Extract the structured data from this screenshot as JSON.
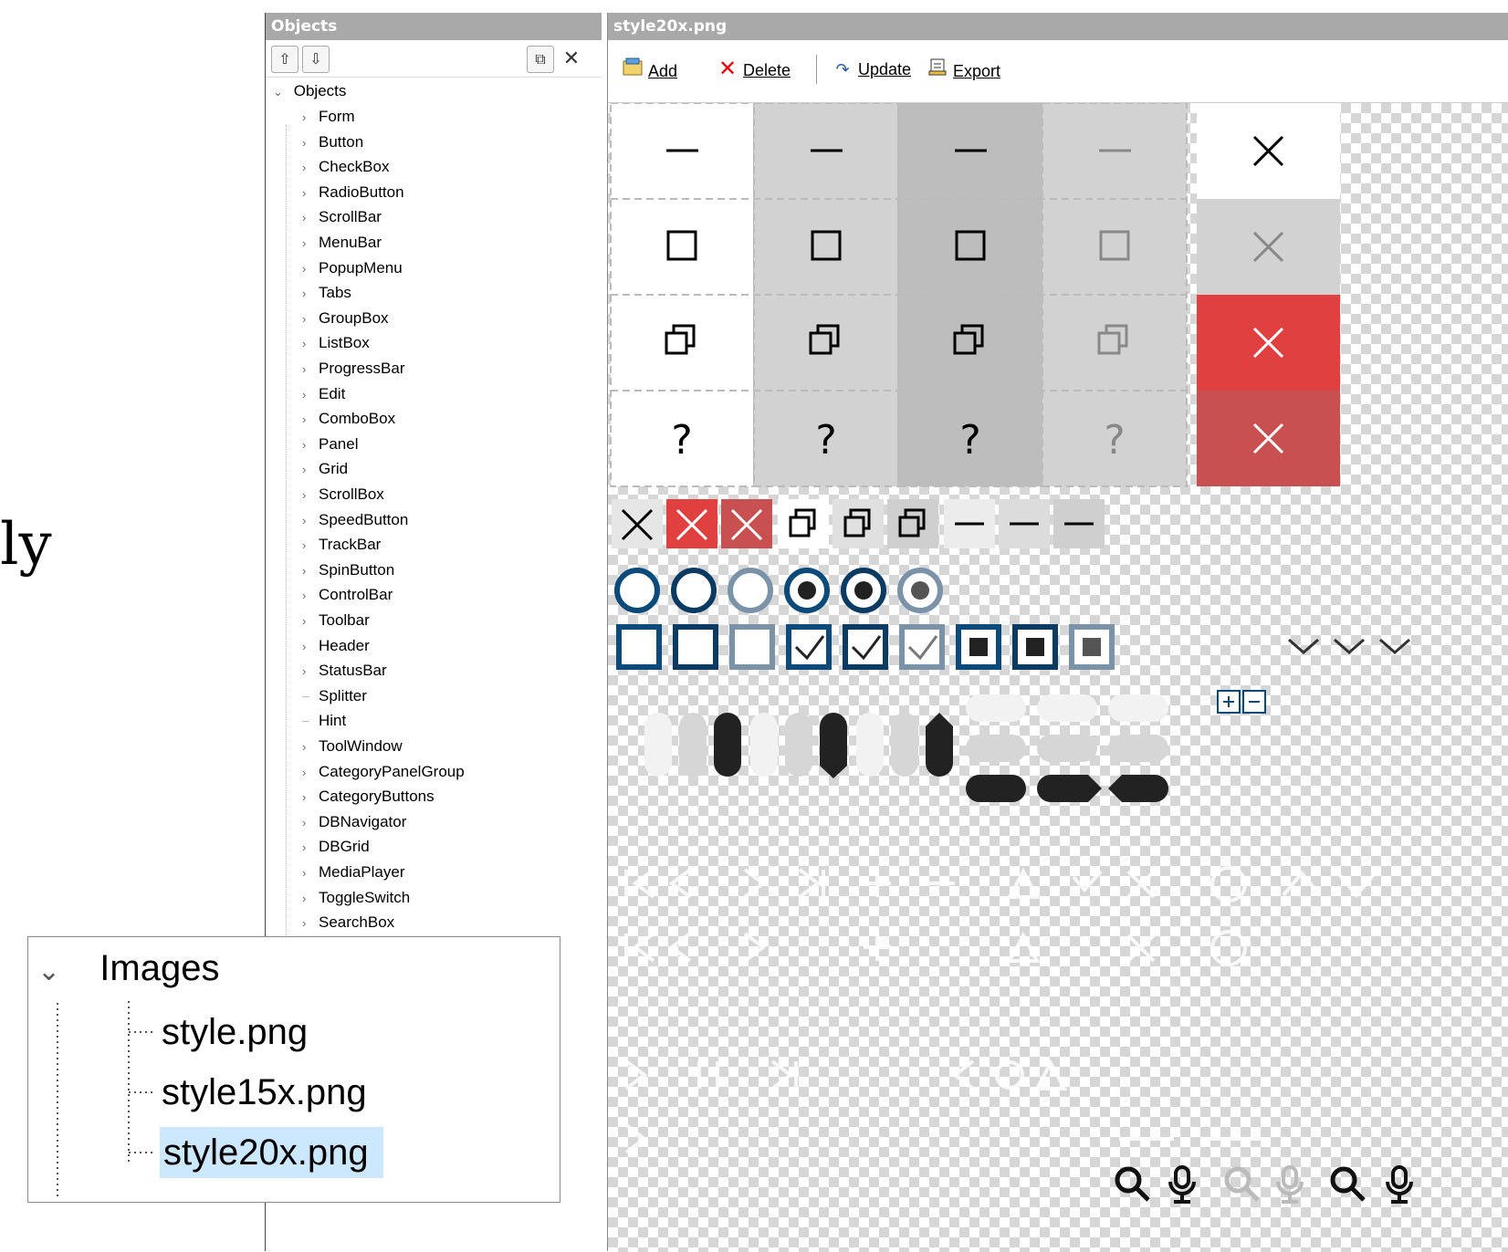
{
  "fragment_text": "ly",
  "objects_panel": {
    "title": "Objects",
    "toolbar_icons": [
      "move-up-icon",
      "move-down-icon",
      "copy-icon",
      "close-icon"
    ],
    "root_label": "Objects",
    "items": [
      {
        "label": "Form",
        "expandable": true
      },
      {
        "label": "Button",
        "expandable": true
      },
      {
        "label": "CheckBox",
        "expandable": true
      },
      {
        "label": "RadioButton",
        "expandable": true
      },
      {
        "label": "ScrollBar",
        "expandable": true
      },
      {
        "label": "MenuBar",
        "expandable": true
      },
      {
        "label": "PopupMenu",
        "expandable": true
      },
      {
        "label": "Tabs",
        "expandable": true
      },
      {
        "label": "GroupBox",
        "expandable": true
      },
      {
        "label": "ListBox",
        "expandable": true
      },
      {
        "label": "ProgressBar",
        "expandable": true
      },
      {
        "label": "Edit",
        "expandable": true
      },
      {
        "label": "ComboBox",
        "expandable": true
      },
      {
        "label": "Panel",
        "expandable": true
      },
      {
        "label": "Grid",
        "expandable": true
      },
      {
        "label": "ScrollBox",
        "expandable": true
      },
      {
        "label": "SpeedButton",
        "expandable": true
      },
      {
        "label": "TrackBar",
        "expandable": true
      },
      {
        "label": "SpinButton",
        "expandable": true
      },
      {
        "label": "ControlBar",
        "expandable": true
      },
      {
        "label": "Toolbar",
        "expandable": true
      },
      {
        "label": "Header",
        "expandable": true
      },
      {
        "label": "StatusBar",
        "expandable": true
      },
      {
        "label": "Splitter",
        "expandable": false
      },
      {
        "label": "Hint",
        "expandable": false
      },
      {
        "label": "ToolWindow",
        "expandable": true
      },
      {
        "label": "CategoryPanelGroup",
        "expandable": true
      },
      {
        "label": "CategoryButtons",
        "expandable": true
      },
      {
        "label": "DBNavigator",
        "expandable": true
      },
      {
        "label": "DBGrid",
        "expandable": true
      },
      {
        "label": "MediaPlayer",
        "expandable": true
      },
      {
        "label": "ToggleSwitch",
        "expandable": true
      },
      {
        "label": "SearchBox",
        "expandable": true
      }
    ]
  },
  "image_panel": {
    "title": "style20x.png",
    "toolbar": {
      "add": "Add",
      "delete": "Delete",
      "update": "Update",
      "export": "Export"
    }
  },
  "images_box": {
    "root_label": "Images",
    "files": [
      "style.png",
      "style15x.png",
      "style20x.png"
    ],
    "selected": "style20x.png"
  },
  "colors": {
    "header_bg": "#a9a9a9",
    "selection": "#cce8ff",
    "close_red": "#e03c3c",
    "close_red_dark": "#c84a4a",
    "radio_blue": "#0b4a7a"
  }
}
